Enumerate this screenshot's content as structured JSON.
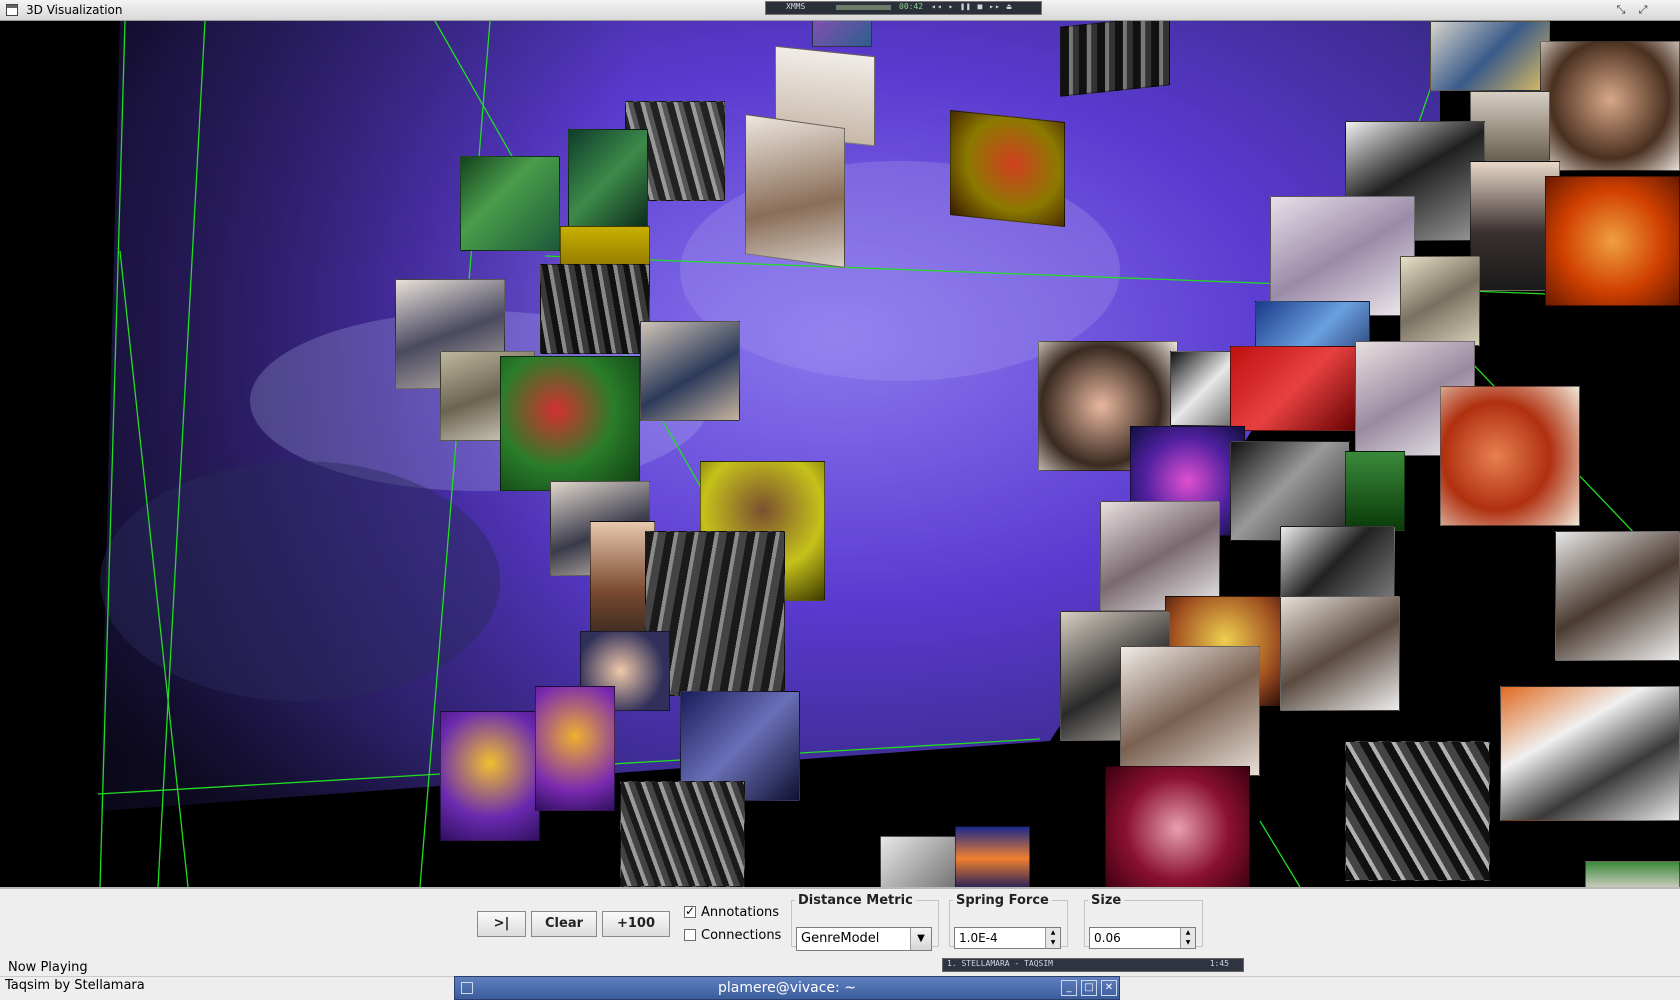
{
  "window": {
    "title": "3D Visualization",
    "controls": [
      "restore-icon",
      "maximize-icon"
    ]
  },
  "xmms": {
    "name": "XMMS",
    "time": "00:42",
    "buttons": "◂◂ ▸ ❚❚ ■ ▸▸ ⏏"
  },
  "toolbar": {
    "skip_label": ">|",
    "clear_label": "Clear",
    "add100_label": "+100"
  },
  "options": {
    "annotations_label": "Annotations",
    "annotations_checked": true,
    "connections_label": "Connections",
    "connections_checked": false
  },
  "distance_metric": {
    "legend": "Distance Metric",
    "selected": "GenreModel"
  },
  "spring_force": {
    "legend": "Spring Force",
    "value": "1.0E-4"
  },
  "size": {
    "legend": "Size",
    "value": "0.06"
  },
  "now_playing": {
    "label": "Now Playing",
    "track": "Taqsim by Stellamara"
  },
  "playlist": {
    "entry": "1. STELLAMARA - TAQSIM",
    "duration": "1:45"
  },
  "terminal": {
    "title": "plamere@vivace: ~"
  },
  "colors": {
    "grid": "#22dd22",
    "nebula_primary": "#5a3ad0",
    "nebula_light": "#8a78ee",
    "terminal_titlebar": "#4a6aa8",
    "panel_bg": "#eeeeee"
  }
}
